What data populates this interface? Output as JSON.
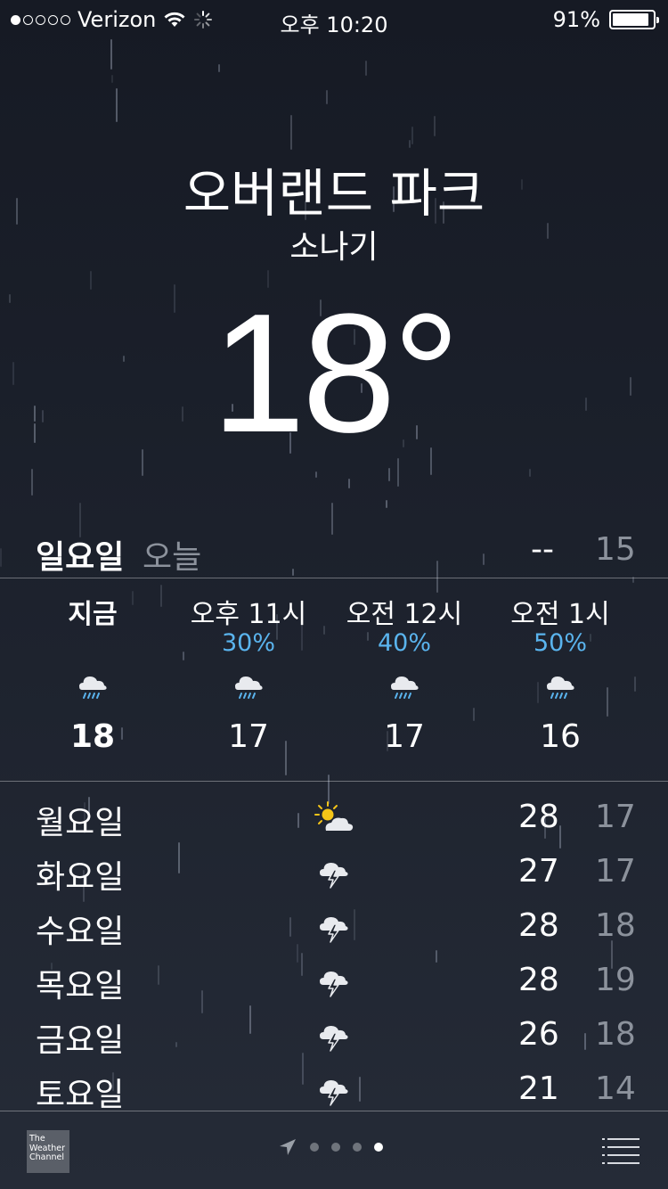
{
  "status_bar": {
    "carrier": "Verizon",
    "time": "오후 10:20",
    "battery": "91%",
    "battery_level": 0.91,
    "signal_bars_filled": 1,
    "signal_bars_total": 5
  },
  "location": {
    "city": "오버랜드 파크",
    "condition": "소나기",
    "temperature": "18°"
  },
  "today": {
    "day": "일요일",
    "label": "오늘",
    "high": "--",
    "low": "15"
  },
  "hourly": [
    {
      "time": "지금",
      "precip": "",
      "icon": "rain-cloud-icon",
      "temp": "18"
    },
    {
      "time": "오후 11시",
      "precip": "30%",
      "icon": "rain-cloud-icon",
      "temp": "17"
    },
    {
      "time": "오전 12시",
      "precip": "40%",
      "icon": "rain-cloud-icon",
      "temp": "17"
    },
    {
      "time": "오전 1시",
      "precip": "50%",
      "icon": "rain-cloud-icon",
      "temp": "16"
    }
  ],
  "daily": [
    {
      "day": "월요일",
      "icon": "partly-sunny-icon",
      "high": "28",
      "low": "17"
    },
    {
      "day": "화요일",
      "icon": "thunderstorm-icon",
      "high": "27",
      "low": "17"
    },
    {
      "day": "수요일",
      "icon": "thunderstorm-icon",
      "high": "28",
      "low": "18"
    },
    {
      "day": "목요일",
      "icon": "thunderstorm-icon",
      "high": "28",
      "low": "19"
    },
    {
      "day": "금요일",
      "icon": "thunderstorm-icon",
      "high": "26",
      "low": "18"
    },
    {
      "day": "토요일",
      "icon": "thunderstorm-icon",
      "high": "21",
      "low": "14"
    }
  ],
  "footer": {
    "provider_logo_text": "The Weather Channel",
    "pages": 4,
    "active_page": 4
  },
  "colors": {
    "precip": "#5ab4ee",
    "secondary_text": "#8c929c",
    "sun": "#f5c518"
  }
}
